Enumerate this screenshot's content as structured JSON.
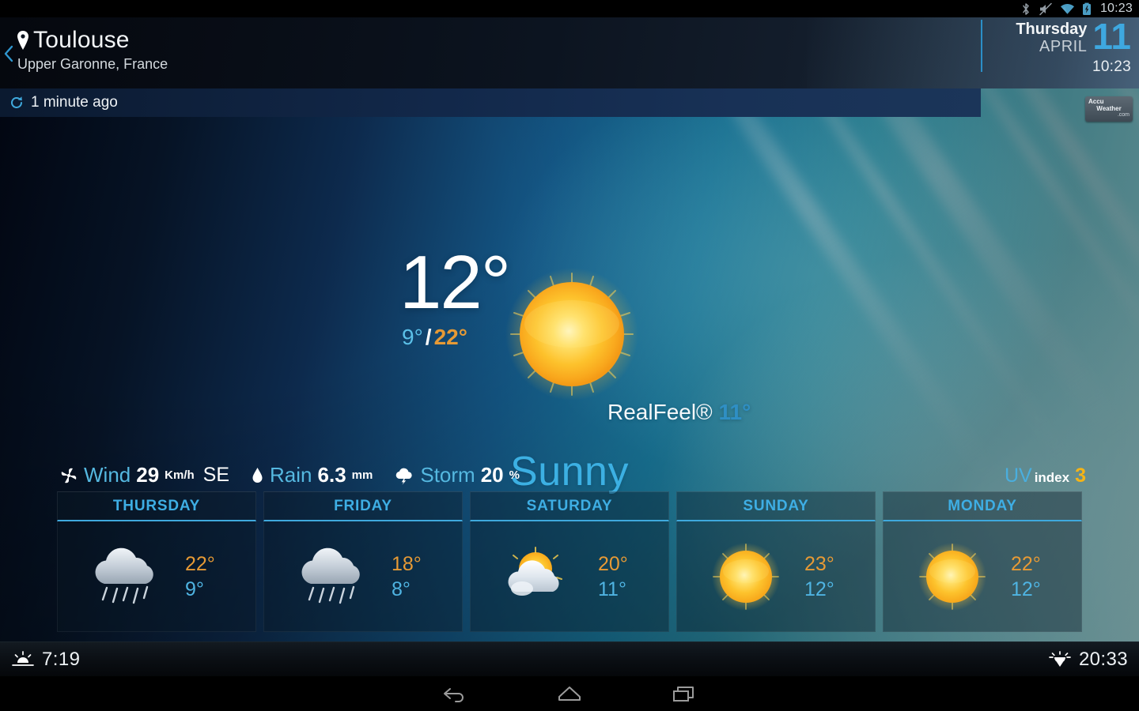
{
  "statusbar": {
    "icons": [
      "bluetooth-icon",
      "volume-mute-icon",
      "wifi-icon",
      "battery-charging-icon"
    ],
    "clock": "10:23"
  },
  "header": {
    "back_icon": "back-chevron-icon",
    "location_pin_icon": "location-pin-icon",
    "city": "Toulouse",
    "region": "Upper Garonne, France",
    "weekday": "Thursday",
    "month": "APRIL",
    "day": "11",
    "time": "10:23"
  },
  "updated": {
    "refresh_icon": "refresh-icon",
    "text": "1 minute ago"
  },
  "brand": {
    "line1": "Accu",
    "line2": "Weather",
    "line3": ".com"
  },
  "current": {
    "temperature": "12°",
    "low": "9°",
    "separator": "/",
    "high": "22°",
    "realfeel_label": "RealFeel®",
    "realfeel_value": "11°",
    "condition": "Sunny",
    "condition_icon": "sun-icon"
  },
  "stats": {
    "wind": {
      "icon": "wind-icon",
      "label": "Wind",
      "value": "29",
      "unit": "Km/h",
      "direction": "SE"
    },
    "rain": {
      "icon": "raindrop-icon",
      "label": "Rain",
      "value": "6.3",
      "unit": "mm"
    },
    "storm": {
      "icon": "storm-cloud-icon",
      "label": "Storm",
      "value": "20",
      "unit": "%"
    },
    "uv": {
      "prefix": "UV",
      "label": "index",
      "value": "3"
    }
  },
  "forecast": [
    {
      "day": "THURSDAY",
      "icon": "rain-cloud-icon",
      "high": "22°",
      "low": "9°"
    },
    {
      "day": "FRIDAY",
      "icon": "rain-cloud-icon",
      "high": "18°",
      "low": "8°"
    },
    {
      "day": "SATURDAY",
      "icon": "partly-cloudy-icon",
      "high": "20°",
      "low": "11°"
    },
    {
      "day": "SUNDAY",
      "icon": "sun-icon",
      "high": "23°",
      "low": "12°"
    },
    {
      "day": "MONDAY",
      "icon": "sun-icon",
      "high": "22°",
      "low": "12°"
    }
  ],
  "sunbar": {
    "sunrise_icon": "sunrise-icon",
    "sunrise": "7:19",
    "sunset_icon": "sunset-icon",
    "sunset": "20:33"
  },
  "navbar": {
    "back": "back-nav-icon",
    "home": "home-nav-icon",
    "recents": "recents-nav-icon"
  },
  "colors": {
    "accent_blue": "#3eaee4",
    "high_orange": "#e79a35",
    "low_blue": "#4fb4e2",
    "uv_yellow": "#f5b417",
    "sun_yellow": "#fdd14a"
  }
}
